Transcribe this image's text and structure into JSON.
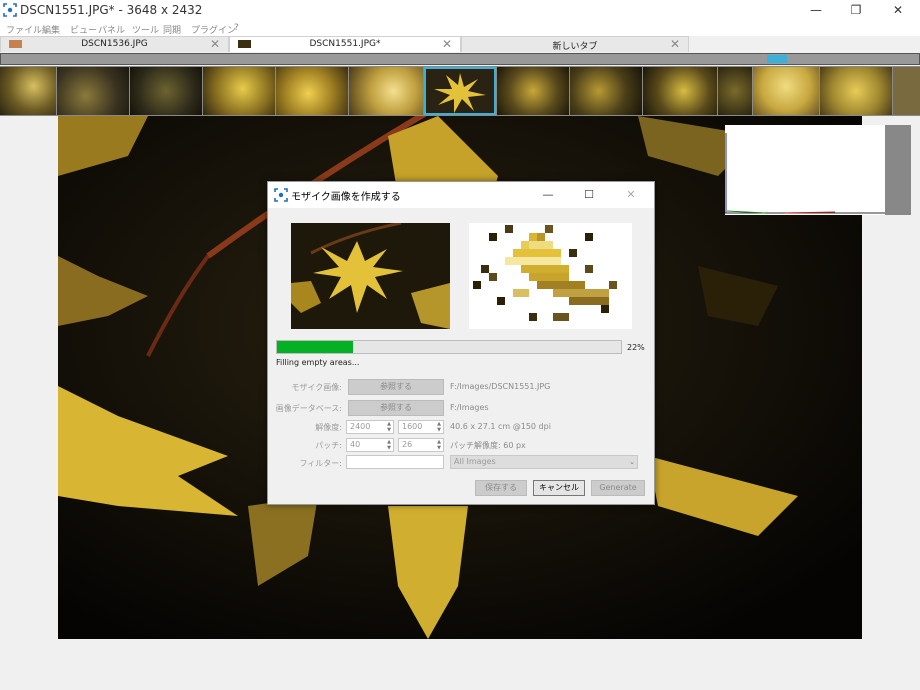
{
  "window": {
    "title": "DSCN1551.JPG* - 3648 x 2432",
    "minimize": "—",
    "maximize": "❐",
    "close": "✕"
  },
  "menu": [
    "ファイル",
    "編集",
    "ビュー",
    "パネル",
    "ツール",
    "同期",
    "プラグイン",
    "?"
  ],
  "tabs": [
    {
      "label": "DSCN1536.JPG",
      "close": "✕"
    },
    {
      "label": "DSCN1551.JPG*",
      "close": "✕"
    },
    {
      "label": "新しいタブ",
      "close": "✕"
    }
  ],
  "dialog": {
    "title": "モザイク画像を作成する",
    "min": "—",
    "max": "☐",
    "close": "✕",
    "progress": {
      "value": 0.22,
      "label": "22%"
    },
    "status": "Filling empty areas...",
    "mosaic_image": {
      "label": "モザイク画像:",
      "browse": "参照する",
      "path": "F:/Images/DSCN1551.JPG"
    },
    "image_db": {
      "label": "画像データベース:",
      "browse": "参照する",
      "path": "F:/Images"
    },
    "resolution": {
      "label": "解像度:",
      "width": "2400",
      "height": "1600",
      "info": "40.6 x 27.1 cm @150 dpi"
    },
    "patch": {
      "label": "パッチ:",
      "cols": "40",
      "rows": "26",
      "info": "パッチ解像度: 60 px"
    },
    "filter": {
      "label": "フィルター:",
      "value": "",
      "select": "All Images"
    },
    "buttons": {
      "save": "保存する",
      "cancel": "キャンセル",
      "generate": "Generate"
    }
  },
  "colors": {
    "accent": "#3bb0d8",
    "progress": "#06b025",
    "leaf": "#e3c23a"
  }
}
